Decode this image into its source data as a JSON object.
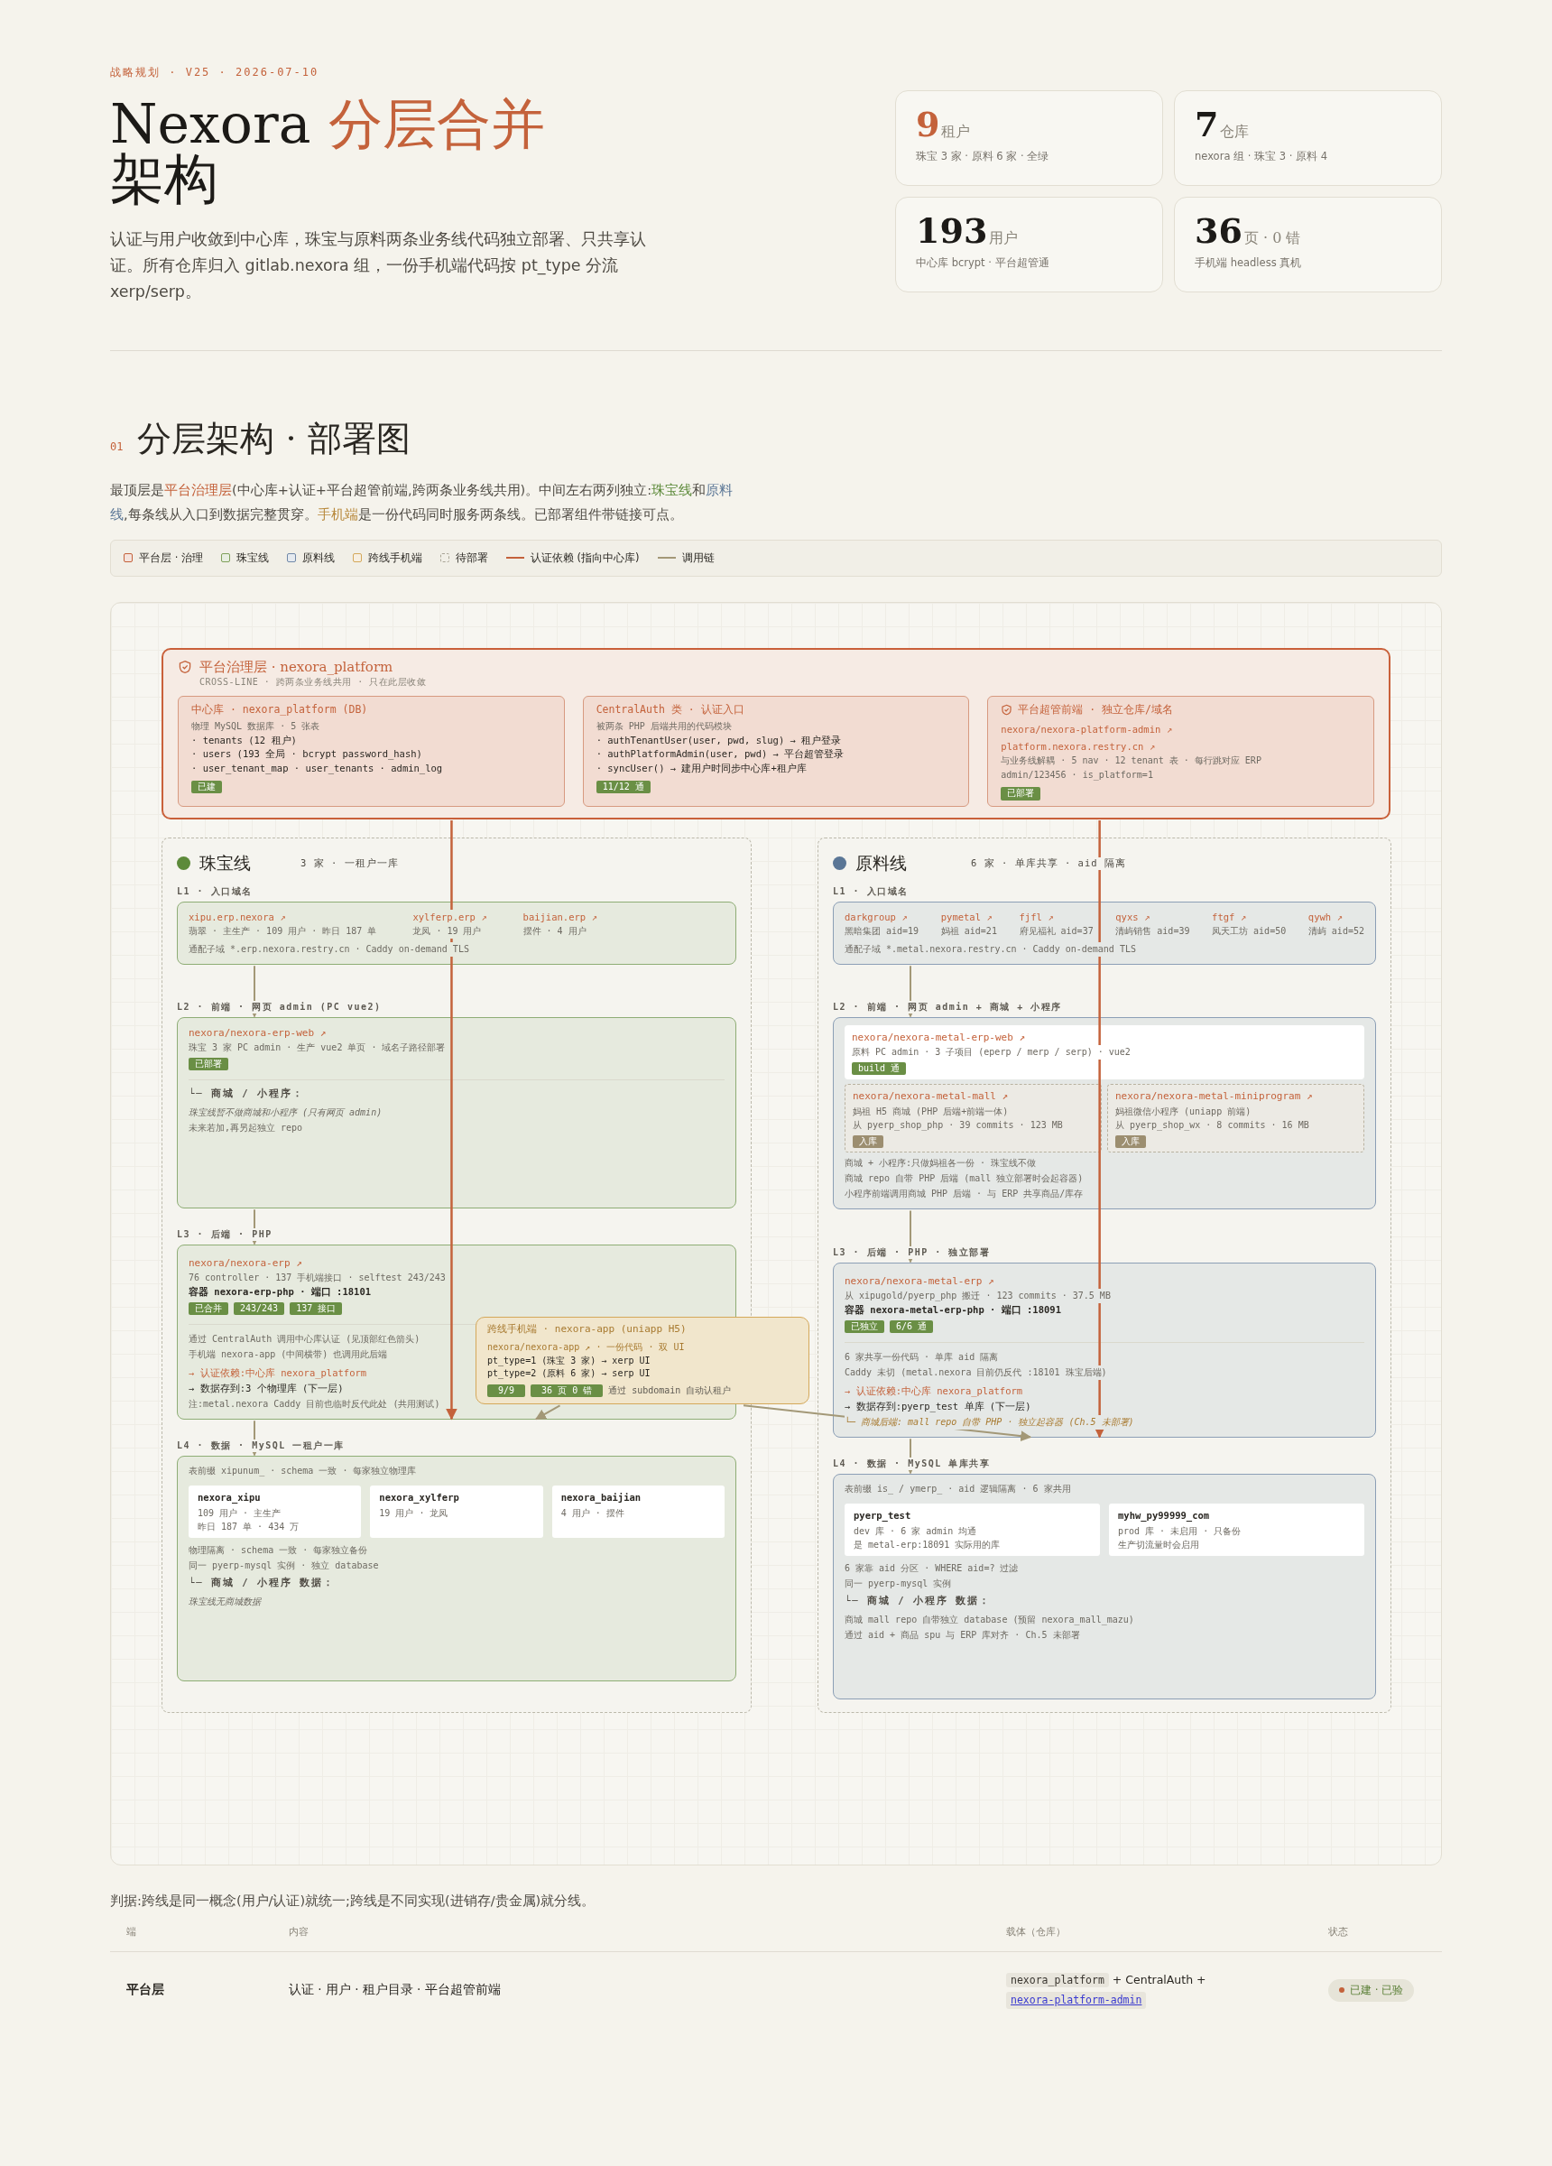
{
  "header": {
    "eyebrow": "战略规划 · V25 · 2026-07-10",
    "title": "Nexora ",
    "title_accent": "分层合并",
    "title_rest": "架构",
    "description": "认证与用户收敛到中心库，珠宝与原料两条业务线代码独立部署、只共享认证。所有仓库归入 gitlab.nexora 组，一份手机端代码按 pt_type 分流 xerp/serp。"
  },
  "stats": [
    {
      "value": "9",
      "unit": "租户",
      "note": "珠宝 3 家 · 原料 6 家 · 全绿",
      "highlighted": true
    },
    {
      "value": "7",
      "unit": "仓库",
      "note": "nexora 组 · 珠宝 3 · 原料 4",
      "highlighted": false
    },
    {
      "value": "193",
      "unit": "用户",
      "note": "中心库 bcrypt · 平台超管通",
      "highlighted": false
    },
    {
      "value": "36",
      "unit": "页 · 0 错",
      "note": "手机端 headless 真机",
      "highlighted": false
    }
  ],
  "section": {
    "number": "01",
    "title": "分层架构 · 部署图",
    "intro": [
      {
        "text": "最顶层是",
        "kind": "plain"
      },
      {
        "text": "平台治理层",
        "kind": "platform"
      },
      {
        "text": "(中心库+认证+平台超管前端,跨两条业务线共用)。中间左右两列独立:",
        "kind": "plain"
      },
      {
        "text": "珠宝线",
        "kind": "jewelry"
      },
      {
        "text": "和",
        "kind": "plain"
      },
      {
        "text": "原料线",
        "kind": "metal"
      },
      {
        "text": ",每条线从入口到数据完整贯穿。",
        "kind": "plain"
      },
      {
        "text": "手机端",
        "kind": "mobile"
      },
      {
        "text": "是一份代码同时服务两条线。已部署组件带链接可点。",
        "kind": "plain"
      }
    ]
  },
  "legend": [
    {
      "label": "平台层 · 治理",
      "kind": "fill",
      "color": "#c4623b"
    },
    {
      "label": "珠宝线",
      "kind": "fill",
      "color": "#7fa05a"
    },
    {
      "label": "原料线",
      "kind": "fill",
      "color": "#7189a8"
    },
    {
      "label": "跨线手机端",
      "kind": "fill",
      "color": "#d4a85a"
    },
    {
      "label": "待部署",
      "kind": "dashed",
      "color": "#a8a495"
    },
    {
      "label": "认证依赖 (指向中心库)",
      "kind": "line",
      "color": "#c4623b"
    },
    {
      "label": "调用链",
      "kind": "line",
      "color": "#a39877"
    }
  ],
  "diagram": {
    "platform": {
      "title": "平台治理层 · nexora_platform",
      "subtitle": "CROSS-LINE · 跨两条业务线共用 · 只在此层收敛",
      "cards": [
        {
          "title": "中心库 · nexora_platform (DB)",
          "shield": false,
          "notes": [
            "物理 MySQL 数据库 · 5 张表"
          ],
          "lines": [
            "· tenants (12 租户)",
            "· users (193 全局 · bcrypt password_hash)",
            "· user_tenant_map · user_tenants · admin_log"
          ],
          "badge": "已建"
        },
        {
          "title": "CentralAuth 类 · 认证入口",
          "shield": false,
          "notes": [
            "被两条 PHP 后端共用的代码模块"
          ],
          "lines": [
            "· authTenantUser(user, pwd, slug) → 租户登录",
            "· authPlatformAdmin(user, pwd) → 平台超管登录",
            "· syncUser() → 建用户时同步中心库+租户库"
          ],
          "badge": "11/12 通"
        },
        {
          "title": "平台超管前端 · 独立仓库/域名",
          "shield": true,
          "links": [
            "nexora/nexora-platform-admin ↗",
            "platform.nexora.restry.cn ↗"
          ],
          "notes": [
            "与业务线解耦 · 5 nav · 12 tenant 表 · 每行跳对应 ERP",
            "admin/123456 · is_platform=1"
          ],
          "badge": "已部署"
        }
      ]
    },
    "lanes": [
      {
        "name": "珠宝线",
        "color": "#5d8a3a",
        "summary": "3 家 · 一租户一库",
        "layers": [
          {
            "label": "L1 · 入口域名",
            "kind": "domains",
            "domains": [
              {
                "link": "xipu.erp.nexora ↗",
                "note": "翡翠 · 主生产 · 109 用户 · 昨日 187 单"
              },
              {
                "link": "xylferp.erp ↗",
                "note": "龙凤 · 19 用户"
              },
              {
                "link": "baijian.erp ↗",
                "note": "摆件 · 4 用户"
              }
            ],
            "footer": "通配子域 *.erp.nexora.restry.cn · Caddy on-demand TLS"
          },
          {
            "label": "L2 · 前端 · 网页 admin (PC vue2)",
            "kind": "frontend",
            "repos": [
              {
                "kind": "inline",
                "link": "nexora/nexora-erp-web ↗",
                "note": "珠宝 3 家 PC admin · 生产 vue2 单页 · 域名子路径部署",
                "badges": [
                  "已部署"
                ]
              }
            ],
            "sub": {
              "heading": "└─ 商城 / 小程序：",
              "lines": [
                {
                  "text": "珠宝线暂不做商城和小程序 (只有网页 admin)",
                  "italic": true
                },
                {
                  "text": "未来若加,再另起独立 repo",
                  "italic": false
                }
              ]
            }
          },
          {
            "label": "L3 · 后端 · PHP",
            "kind": "backend",
            "link": "nexora/nexora-erp ↗",
            "note": "76 controller · 137 手机端接口 · selftest 243/243",
            "container": "容器 nexora-erp-php · 端口 :18101",
            "badges": [
              "已合并",
              "243/243",
              "137 接口"
            ],
            "notes": [
              "通过 CentralAuth 调用中心库认证 (见顶部红色箭头)",
              "手机端 nexora-app (中间横带) 也调用此后端"
            ],
            "auth": "→ 认证依赖:中心库 nexora_platform",
            "data": "→ 数据存到:3 个物理库 (下一层)",
            "footnote": {
              "text": "注:metal.nexora Caddy 目前也临时反代此处 (共用测试)",
              "kind": "note"
            }
          },
          {
            "label": "L4 · 数据 · MySQL 一租户一库",
            "kind": "data",
            "note": "表前缀 xipunum_ · schema 一致 · 每家独立物理库",
            "databases": [
              {
                "name": "nexora_xipu",
                "lines": [
                  "109 用户 · 主生产",
                  "昨日 187 单 · 434 万"
                ]
              },
              {
                "name": "nexora_xylferp",
                "lines": [
                  "19 用户 · 龙凤"
                ]
              },
              {
                "name": "nexora_baijian",
                "lines": [
                  "4 用户 · 摆件"
                ]
              }
            ],
            "notes": [
              "物理隔离 · schema 一致 · 每家独立备份",
              "同一 pyerp-mysql 实例 · 独立 database"
            ],
            "sub": {
              "heading": "└─ 商城 / 小程序 数据：",
              "lines": [
                {
                  "text": "珠宝线无商城数据",
                  "italic": true
                }
              ]
            }
          }
        ]
      },
      {
        "name": "原料线",
        "color": "#5a7696",
        "summary": "6 家 · 单库共享 · aid 隔离",
        "layers": [
          {
            "label": "L1 · 入口域名",
            "kind": "domains",
            "domains": [
              {
                "link": "darkgroup ↗",
                "note": "黑暗集团 aid=19"
              },
              {
                "link": "pymetal ↗",
                "note": "妈祖 aid=21"
              },
              {
                "link": "fjfl ↗",
                "note": "府见福礼 aid=37"
              },
              {
                "link": "qyxs ↗",
                "note": "清屿销售 aid=39"
              },
              {
                "link": "ftgf ↗",
                "note": "凤天工坊 aid=50"
              },
              {
                "link": "qywh ↗",
                "note": "清屿 aid=52"
              }
            ],
            "footer": "通配子域 *.metal.nexora.restry.cn · Caddy on-demand TLS"
          },
          {
            "label": "L2 · 前端 · 网页 admin + 商城 + 小程序",
            "kind": "frontend",
            "repos": [
              {
                "kind": "main",
                "link": "nexora/nexora-metal-erp-web ↗",
                "note": "原料 PC admin · 3 子项目 (eperp / merp / serp) · vue2",
                "badges": [
                  "build 通"
                ]
              },
              {
                "kind": "pending",
                "link": "nexora/nexora-metal-mall ↗",
                "note": "妈祖 H5 商城 (PHP 后端+前端一体)",
                "note2": "从 pyerp_shop_php · 39 commits · 123 MB",
                "badges": [
                  "入库"
                ]
              },
              {
                "kind": "pending",
                "link": "nexora/nexora-metal-miniprogram ↗",
                "note": "妈祖微信小程序 (uniapp 前端)",
                "note2": "从 pyerp_shop_wx · 8 commits · 16 MB",
                "badges": [
                  "入库"
                ]
              }
            ],
            "sub": {
              "lines": [
                {
                  "text": "商城 + 小程序:只做妈祖各一份 · 珠宝线不做",
                  "italic": false
                },
                {
                  "text": "商城 repo 自带 PHP 后端 (mall 独立部署时会起容器)",
                  "italic": false
                },
                {
                  "text": "小程序前端调用商城 PHP 后端 · 与 ERP 共享商品/库存",
                  "italic": false
                }
              ]
            }
          },
          {
            "label": "L3 · 后端 · PHP · 独立部署",
            "kind": "backend",
            "link": "nexora/nexora-metal-erp ↗",
            "note": "从 xipugold/pyerp_php 搬迁 · 123 commits · 37.5 MB",
            "container": "容器 nexora-metal-erp-php · 端口 :18091",
            "badges": [
              "已独立",
              "6/6 通"
            ],
            "notes": [
              "6 家共享一份代码 · 单库 aid 隔离",
              "Caddy 未切 (metal.nexora 目前仍反代 :18101 珠宝后端)"
            ],
            "auth": "→ 认证依赖:中心库 nexora_platform",
            "data": "→ 数据存到:pyerp_test 单库 (下一层)",
            "footnote": {
              "text": "└─ 商城后端: mall repo 自带 PHP · 独立起容器 (Ch.5 未部署)",
              "kind": "pending"
            }
          },
          {
            "label": "L4 · 数据 · MySQL 单库共享",
            "kind": "data",
            "note": "表前缀 is_ / ymerp_ · aid 逻辑隔离 · 6 家共用",
            "databases": [
              {
                "name": "pyerp_test",
                "lines": [
                  "dev 库 · 6 家 admin 均通",
                  "是 metal-erp:18091 实际用的库"
                ]
              },
              {
                "name": "myhw_py99999_com",
                "lines": [
                  "prod 库 · 未启用 · 只备份",
                  "生产切流量时会启用"
                ]
              }
            ],
            "notes": [
              "6 家靠 aid 分区 · WHERE aid=? 过滤",
              "同一 pyerp-mysql 实例"
            ],
            "sub": {
              "heading": "└─ 商城 / 小程序 数据：",
              "lines": [
                {
                  "text": "商城 mall repo 自带独立 database (预留 nexora_mall_mazu)",
                  "italic": false
                },
                {
                  "text": "通过 aid + 商品 spu 与 ERP 库对齐 · Ch.5 未部署",
                  "italic": false
                }
              ]
            }
          }
        ]
      }
    ],
    "mobile": {
      "title": "跨线手机端 · nexora-app (uniapp H5)",
      "link": "nexora/nexora-app ↗",
      "note": "· 一份代码 · 双 UI",
      "lines": [
        "pt_type=1 (珠宝 3 家) → xerp UI",
        "pt_type=2 (原料 6 家) → serp UI"
      ],
      "badges": [
        "9/9",
        "36 页 0 错"
      ],
      "tail": "通过 subdomain 自动认租户"
    }
  },
  "verdict": "判据:跨线是同一概念(用户/认证)就统一;跨线是不同实现(进销存/贵金属)就分线。",
  "table": {
    "columns": [
      "端",
      "内容",
      "载体（仓库）",
      "状态"
    ],
    "rows": [
      {
        "layer": "平台层",
        "content": "认证 · 用户 · 租户目录 · 平台超管前端",
        "carrier": [
          {
            "kind": "code",
            "text": "nexora_platform"
          },
          {
            "kind": "text",
            "text": "+ CentralAuth +"
          },
          {
            "kind": "link",
            "text": "nexora-platform-admin"
          }
        ],
        "status": "已建 · 已验"
      }
    ]
  }
}
